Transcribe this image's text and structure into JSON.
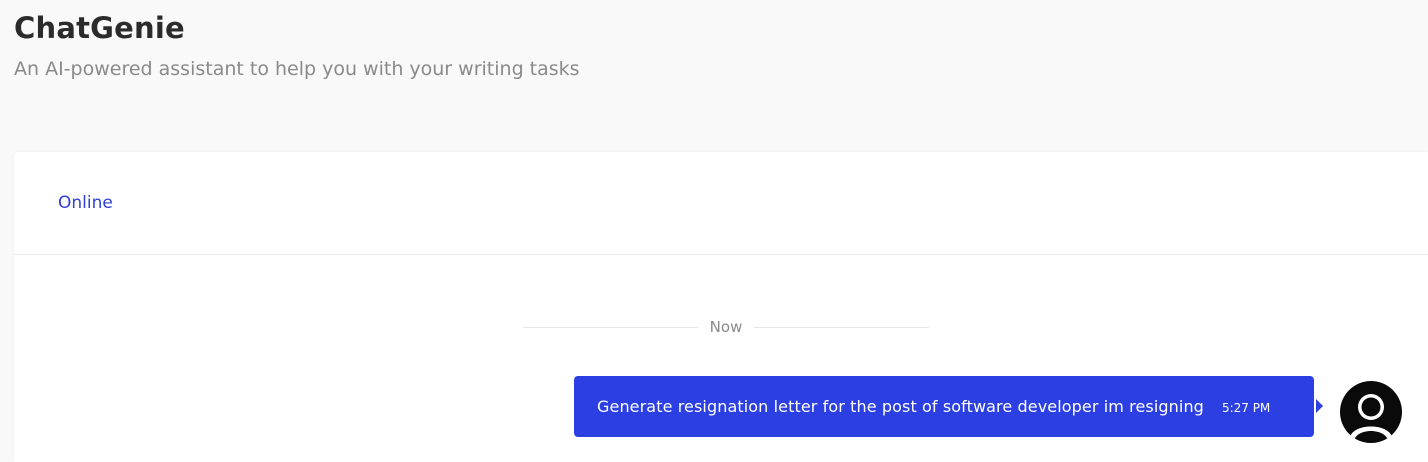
{
  "header": {
    "title": "ChatGenie",
    "subtitle": "An AI-powered assistant to help you with your writing tasks"
  },
  "chat": {
    "status": "Online",
    "divider_label": "Now",
    "messages": [
      {
        "sender": "user",
        "text": "Generate resignation letter for the post of software developer im resigning",
        "time": "5:27 PM"
      }
    ]
  },
  "colors": {
    "accent": "#2b3fe3",
    "status_online": "#2f3fd6",
    "page_background": "#f9f9f9",
    "card_background": "#ffffff",
    "avatar": "#0a0a0a"
  },
  "icons": {
    "avatar": "user-avatar-icon"
  }
}
